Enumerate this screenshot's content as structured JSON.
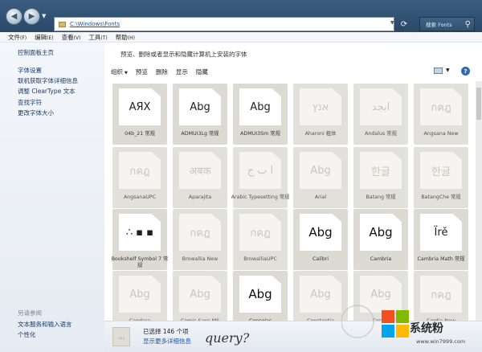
{
  "address": {
    "path": "C:\\Windows\\Fonts"
  },
  "search": {
    "placeholder": "搜索 Fonts"
  },
  "menu": [
    {
      "label": "文件",
      "accel": "(F)"
    },
    {
      "label": "编辑",
      "accel": "(E)"
    },
    {
      "label": "查看",
      "accel": "(V)"
    },
    {
      "label": "工具",
      "accel": "(T)"
    },
    {
      "label": "帮助",
      "accel": "(H)"
    }
  ],
  "sidebar": {
    "home": "控制面板主页",
    "links": [
      "字体设置",
      "联机获取字体详细信息",
      "调整 ClearType 文本",
      "查找字符",
      "更改字体大小"
    ],
    "see_also": "另请参阅",
    "bottom_links": [
      "文本服务和输入语言",
      "个性化"
    ]
  },
  "main": {
    "description": "预览、删除或者显示和隐藏计算机上安装的字体",
    "toolbar": {
      "organize": "组织",
      "preview": "预览",
      "delete": "删除",
      "show": "显示",
      "hide": "隐藏"
    }
  },
  "fonts": [
    {
      "name": "04b_21 常规",
      "sample": "ΑЯΧ",
      "style": "h"
    },
    {
      "name": "ADMUI3Lg 常规",
      "sample": "Abg",
      "style": "h"
    },
    {
      "name": "ADMUI3Sm 常规",
      "sample": "Abg",
      "style": "h"
    },
    {
      "name": "Aharoni 粗体",
      "sample": "אנץ",
      "style": "s"
    },
    {
      "name": "Andalus 常规",
      "sample": "ابجد",
      "style": "s"
    },
    {
      "name": "Angsana New",
      "sample": "กคฎ",
      "style": "s"
    },
    {
      "name": "AngsanaUPC",
      "sample": "กคฎ",
      "style": "s"
    },
    {
      "name": "Aparajita",
      "sample": "अबक",
      "style": "s"
    },
    {
      "name": "Arabic Typesetting 常规",
      "sample": "ا ب ج",
      "style": "s"
    },
    {
      "name": "Arial",
      "sample": "Abg",
      "style": "s"
    },
    {
      "name": "Batang 常规",
      "sample": "한글",
      "style": "s"
    },
    {
      "name": "BatangChe 常规",
      "sample": "한글",
      "style": "s"
    },
    {
      "name": "Bookshelf Symbol 7 常规",
      "sample": "∴ ▪ ▪",
      "style": "h"
    },
    {
      "name": "Browallia New",
      "sample": "กคฎ",
      "style": "s"
    },
    {
      "name": "BrowalliaUPC",
      "sample": "กคฎ",
      "style": "s"
    },
    {
      "name": "Calibri",
      "sample": "Abg",
      "style": "stack"
    },
    {
      "name": "Cambria",
      "sample": "Abg",
      "style": "stack"
    },
    {
      "name": "Cambria Math 常规",
      "sample": "Ïrě",
      "style": "h"
    },
    {
      "name": "Candara",
      "sample": "Abg",
      "style": "s"
    },
    {
      "name": "Comic Sans MS",
      "sample": "Abg",
      "style": "s"
    },
    {
      "name": "Consolas",
      "sample": "Abg",
      "style": "stack"
    },
    {
      "name": "Constantia",
      "sample": "Abg",
      "style": "s"
    },
    {
      "name": "Corbel",
      "sample": "Abg",
      "style": "s"
    },
    {
      "name": "Cordia New",
      "sample": "กคฎ",
      "style": "s"
    }
  ],
  "status": {
    "thumb_label": "กคฎ",
    "selected": "已选择 146 个项",
    "more_details": "显示更多详细信息",
    "handwriting": "query?"
  },
  "watermark": {
    "text": "系统粉",
    "url": "www.win7999.com"
  }
}
